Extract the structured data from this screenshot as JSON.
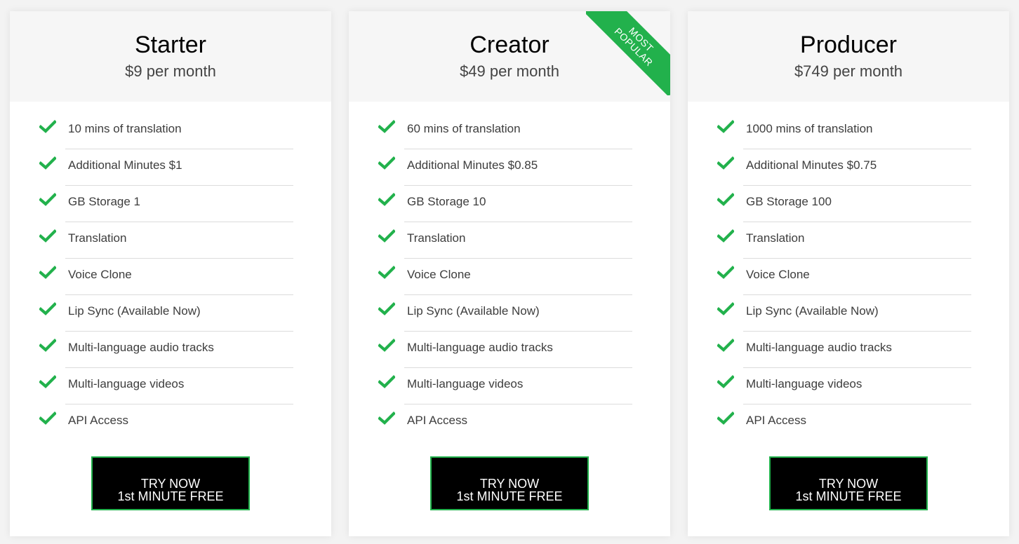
{
  "colors": {
    "accent": "#22b14c",
    "header_bg": "#f6f6f6",
    "button_bg": "#000000"
  },
  "plans": [
    {
      "name": "Starter",
      "price": "$9 per month",
      "badge": null,
      "features": [
        {
          "icon": "check-icon",
          "label": "10 mins of translation"
        },
        {
          "icon": "check-icon",
          "label": "Additional Minutes $1"
        },
        {
          "icon": "check-icon",
          "label": "GB Storage 1"
        },
        {
          "icon": "check-icon",
          "label": "Translation"
        },
        {
          "icon": "check-icon",
          "label": "Voice Clone"
        },
        {
          "icon": "check-icon",
          "label": "Lip Sync (Available Now)"
        },
        {
          "icon": "check-icon",
          "label": "Multi-language audio tracks"
        },
        {
          "icon": "check-icon",
          "label": "Multi-language videos"
        },
        {
          "icon": "check-icon",
          "label": "API Access"
        }
      ],
      "cta": {
        "line1": "TRY NOW",
        "line2": "1st MINUTE FREE"
      }
    },
    {
      "name": "Creator",
      "price": "$49 per month",
      "badge": {
        "line1": "MOST",
        "line2": "POPULAR"
      },
      "features": [
        {
          "icon": "check-icon",
          "label": "60 mins of translation"
        },
        {
          "icon": "check-icon",
          "label": "Additional Minutes $0.85"
        },
        {
          "icon": "check-icon",
          "label": "GB Storage 10"
        },
        {
          "icon": "check-icon",
          "label": "Translation"
        },
        {
          "icon": "check-icon",
          "label": "Voice Clone"
        },
        {
          "icon": "check-icon",
          "label": "Lip Sync (Available Now)"
        },
        {
          "icon": "check-icon",
          "label": "Multi-language audio tracks"
        },
        {
          "icon": "check-icon",
          "label": "Multi-language videos"
        },
        {
          "icon": "check-icon",
          "label": "API Access"
        }
      ],
      "cta": {
        "line1": "TRY NOW",
        "line2": "1st MINUTE FREE"
      }
    },
    {
      "name": "Producer",
      "price": "$749 per month",
      "badge": null,
      "features": [
        {
          "icon": "check-icon",
          "label": "1000 mins of translation"
        },
        {
          "icon": "check-icon",
          "label": "Additional Minutes $0.75"
        },
        {
          "icon": "check-icon",
          "label": "GB Storage 100"
        },
        {
          "icon": "check-icon",
          "label": "Translation"
        },
        {
          "icon": "check-icon",
          "label": "Voice Clone"
        },
        {
          "icon": "check-icon",
          "label": "Lip Sync (Available Now)"
        },
        {
          "icon": "check-icon",
          "label": "Multi-language audio tracks"
        },
        {
          "icon": "check-icon",
          "label": "Multi-language videos"
        },
        {
          "icon": "check-icon",
          "label": "API Access"
        }
      ],
      "cta": {
        "line1": "TRY NOW",
        "line2": "1st MINUTE FREE"
      }
    }
  ]
}
